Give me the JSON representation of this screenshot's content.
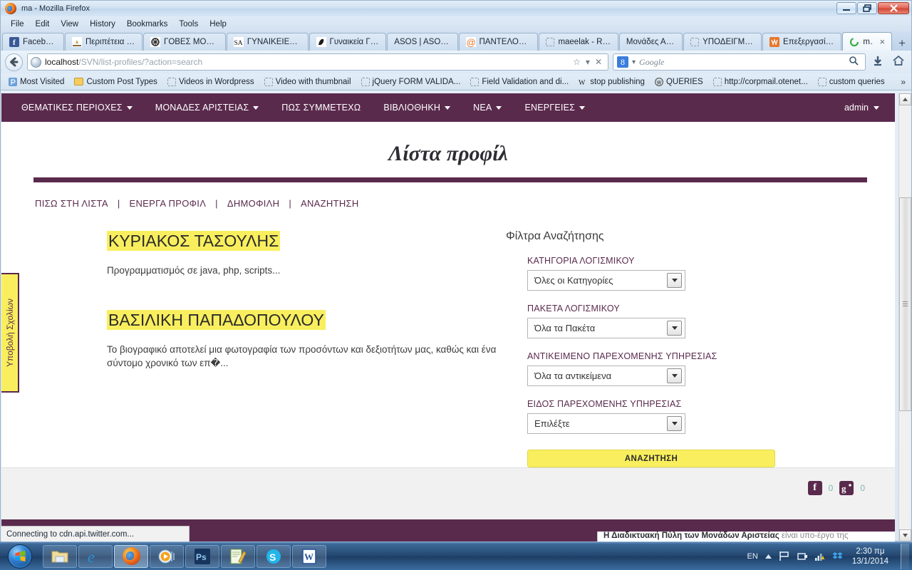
{
  "window": {
    "title": "ma - Mozilla Firefox",
    "menu": [
      "File",
      "Edit",
      "View",
      "History",
      "Bookmarks",
      "Tools",
      "Help"
    ],
    "buttons": {
      "minimize": "minimize-button",
      "maximize": "maximize-button",
      "close": "close-button"
    }
  },
  "tabs": [
    {
      "label": "Facebook",
      "icon": "facebook-icon",
      "active": false
    },
    {
      "label": "Περιπέτεια | ...",
      "icon": "site-icon",
      "active": false
    },
    {
      "label": "ΓΟΒΕΣ MOD:...",
      "icon": "site-icon",
      "active": false
    },
    {
      "label": "ΓΥΝΑΙΚΕΙΕΣ ...",
      "icon": "sa-icon",
      "active": false
    },
    {
      "label": "Γυναικεία Γό...",
      "icon": "shoe-icon",
      "active": false
    },
    {
      "label": "ASOS | ASOS...",
      "icon": "none",
      "active": false
    },
    {
      "label": "ΠΑΝΤΕΛΟΝΙ...",
      "icon": "at-icon",
      "active": false
    },
    {
      "label": "maeelak - Re...",
      "icon": "blank-icon",
      "active": false
    },
    {
      "label": "Μονάδες Αρ...",
      "icon": "none",
      "active": false
    },
    {
      "label": "ΥΠΟΔΕΙΓΜΑ...",
      "icon": "blank-icon",
      "active": false
    },
    {
      "label": "Επεξεργασία...",
      "icon": "wordpress-icon",
      "active": false
    },
    {
      "label": "ma",
      "icon": "loading-icon",
      "active": true
    }
  ],
  "tab_new_label": "+",
  "tab_close_label": "×",
  "urlbar": {
    "host": "localhost",
    "path": "/SVN/list-profiles/?action=search",
    "star": "☆",
    "dropdown": "▾",
    "stop": "✕"
  },
  "searchbar": {
    "engine_badge": "8",
    "engine_caret": "▾",
    "placeholder": "Google"
  },
  "bookmarks": [
    {
      "label": "Most Visited",
      "icon": "most-visited-icon"
    },
    {
      "label": "Custom Post Types",
      "icon": "folder-icon"
    },
    {
      "label": "Videos in Wordpress",
      "icon": "blank-icon"
    },
    {
      "label": "Video with thumbnail",
      "icon": "blank-icon"
    },
    {
      "label": "jQuery FORM VALIDA...",
      "icon": "blank-icon"
    },
    {
      "label": "Field Validation and di...",
      "icon": "blank-icon"
    },
    {
      "label": "stop publishing",
      "icon": "w-icon"
    },
    {
      "label": "QUERIES",
      "icon": "wordpress-icon"
    },
    {
      "label": "http://corpmail.otenet...",
      "icon": "blank-icon"
    },
    {
      "label": "custom queries",
      "icon": "blank-icon"
    }
  ],
  "bookmarks_overflow": "»",
  "sitenav": {
    "items": [
      {
        "label": "ΘΕΜΑΤΙΚΕΣ ΠΕΡΙΟΧΕΣ",
        "has_caret": true
      },
      {
        "label": "ΜΟΝΑΔΕΣ ΑΡΙΣΤΕΙΑΣ",
        "has_caret": true
      },
      {
        "label": "ΠΩΣ ΣΥΜΜΕΤΕΧΩ",
        "has_caret": false
      },
      {
        "label": "ΒΙΒΛΙΟΘΗΚΗ",
        "has_caret": true
      },
      {
        "label": "ΝΕΑ",
        "has_caret": true
      },
      {
        "label": "ΕΝΕΡΓΕΙΕΣ",
        "has_caret": true
      }
    ],
    "user": "admin"
  },
  "page": {
    "title": "Λίστα προφίλ",
    "subnav": [
      "ΠΙΣΩ ΣΤΗ ΛΙΣΤΑ",
      "ΕΝΕΡΓΑ ΠΡΟΦΙΛ",
      "ΔΗΜΟΦΙΛΗ",
      "ΑΝΑΖΗΤΗΣΗ"
    ],
    "subnav_separator": "|",
    "profiles": [
      {
        "name": "ΚΥΡΙΑΚΟΣ ΤΑΣΟΥΛΗΣ",
        "desc": "Προγραμματισμός σε java, php, scripts..."
      },
      {
        "name": "ΒΑΣΙΛΙΚΗ ΠΑΠΑΔΟΠΟΥΛΟΥ",
        "desc": "Το βιογραφικό αποτελεί μια φωτογραφία των προσόντων και δεξιοτήτων μας, καθώς και ένα σύντομο χρονικό των επ�..."
      }
    ],
    "filters": {
      "heading": "Φίλτρα Αναζήτησης",
      "fields": [
        {
          "label": "ΚΑΤΗΓΟΡΙΑ ΛΟΓΙΣΜΙΚΟΥ",
          "value": "Όλες οι Κατηγορίες"
        },
        {
          "label": "ΠΑΚΕΤΑ ΛΟΓΙΣΜΙΚΟΥ",
          "value": "Όλα τα Πακέτα"
        },
        {
          "label": "ΑΝΤΙΚΕΙΜΕΝΟ ΠΑΡΕΧΟΜΕΝΗΣ ΥΠΗΡΕΣΙΑΣ",
          "value": "Όλα τα αντικείμενα"
        },
        {
          "label": "ΕΙΔΟΣ ΠΑΡΕΧΟΜΕΝΗΣ ΥΠΗΡΕΣΙΑΣ",
          "value": "Επιλέξτε"
        }
      ],
      "submit": "ΑΝΑΖΗΤΗΣΗ"
    },
    "feedback_tab": "Υποβολή Σχολίων",
    "social": [
      {
        "icon": "facebook-icon",
        "glyph": "f",
        "count": "0"
      },
      {
        "icon": "google-plus-icon",
        "glyph": "g",
        "count": "0"
      }
    ],
    "footer_note_bold": "Η Διαδικτυακή Πύλη των Μονάδων Αριστείας",
    "footer_note_rest": " είναι υπο-έργο της"
  },
  "status": "Connecting to cdn.api.twitter.com...",
  "taskbar": {
    "items": [
      {
        "name": "explorer",
        "icon": "folder-icon"
      },
      {
        "name": "internet-explorer",
        "icon": "ie-icon"
      },
      {
        "name": "firefox",
        "icon": "firefox-icon",
        "active": true
      },
      {
        "name": "media-player",
        "icon": "media-player-icon"
      },
      {
        "name": "photoshop",
        "icon": "photoshop-icon",
        "label": "Ps"
      },
      {
        "name": "notepadpp",
        "icon": "notepad-icon"
      },
      {
        "name": "skype",
        "icon": "skype-icon",
        "label": "S"
      },
      {
        "name": "word",
        "icon": "word-icon",
        "label": "W"
      }
    ],
    "tray": {
      "language": "EN",
      "time": "2:30 πμ",
      "date": "13/1/2014"
    }
  },
  "colors": {
    "brand_purple": "#5a2a4d",
    "highlight_yellow": "#f9ef5e",
    "link_purple": "#5a2a4d"
  }
}
